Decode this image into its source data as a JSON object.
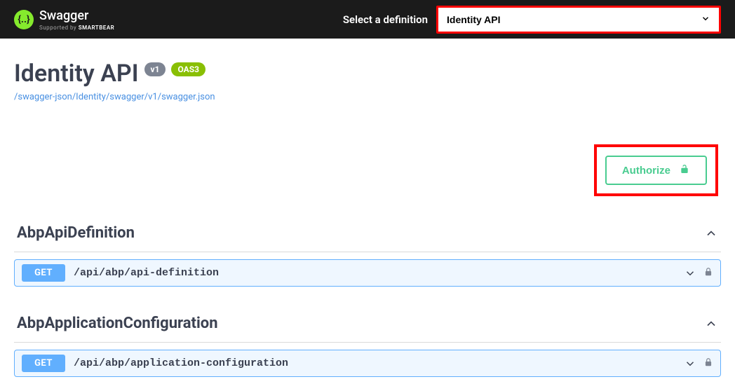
{
  "topbar": {
    "brand_name": "Swagger",
    "brand_sub_prefix": "Supported by ",
    "brand_sub_bold": "SMARTBEAR",
    "select_label": "Select a definition",
    "selected_definition": "Identity API"
  },
  "api": {
    "title": "Identity API",
    "version_badge": "v1",
    "oas_badge": "OAS3",
    "spec_url": "/swagger-json/Identity/swagger/v1/swagger.json"
  },
  "auth": {
    "authorize_label": "Authorize"
  },
  "tags": [
    {
      "name": "AbpApiDefinition",
      "operations": [
        {
          "method": "GET",
          "path": "/api/abp/api-definition"
        }
      ]
    },
    {
      "name": "AbpApplicationConfiguration",
      "operations": [
        {
          "method": "GET",
          "path": "/api/abp/application-configuration"
        }
      ]
    }
  ]
}
